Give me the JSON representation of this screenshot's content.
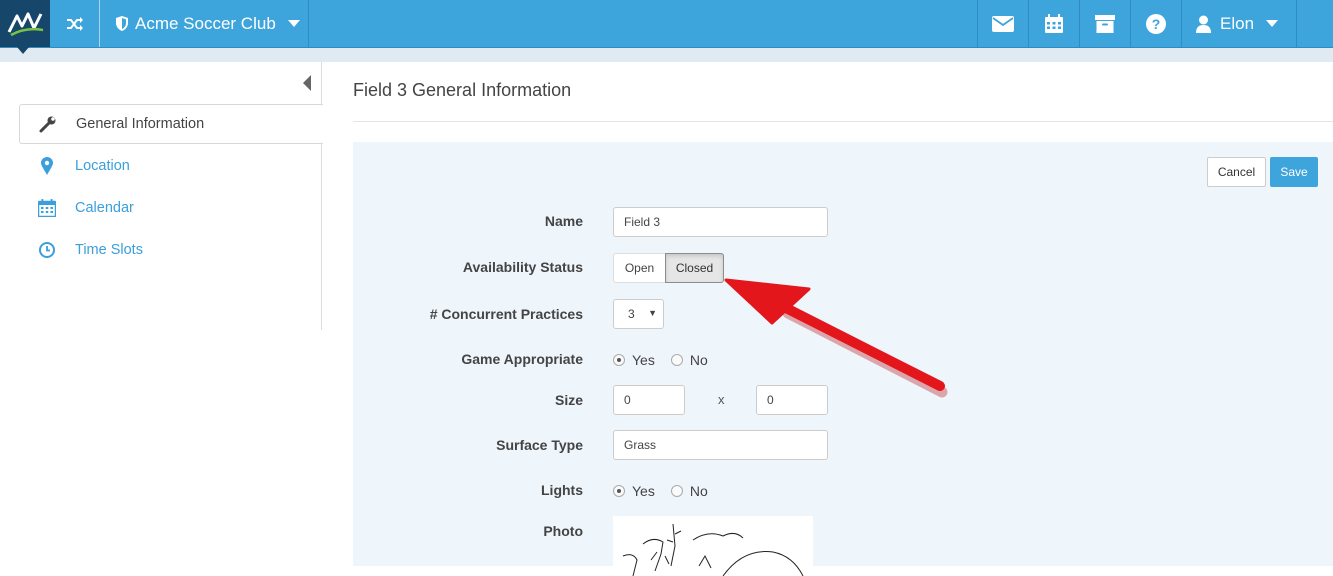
{
  "topbar": {
    "club_name": "Acme Soccer Club",
    "user_name": "Elon",
    "icons": [
      "shuffle-icon",
      "shield-icon",
      "envelope-icon",
      "calendar-icon",
      "archive-icon",
      "help-icon",
      "user-icon"
    ],
    "accent_color": "#3da5dc",
    "logo_bg": "#17466b"
  },
  "sidebar": {
    "items": [
      {
        "label": "General Information",
        "icon": "wrench-icon",
        "active": true
      },
      {
        "label": "Location",
        "icon": "map-marker-icon",
        "active": false
      },
      {
        "label": "Calendar",
        "icon": "calendar-icon",
        "active": false
      },
      {
        "label": "Time Slots",
        "icon": "clock-icon",
        "active": false
      }
    ]
  },
  "main": {
    "title": "Field 3 General Information",
    "actions": {
      "cancel_label": "Cancel",
      "save_label": "Save"
    },
    "form": {
      "name_label": "Name",
      "name_value": "Field 3",
      "availability_label": "Availability Status",
      "availability_options": [
        "Open",
        "Closed"
      ],
      "availability_selected": "Closed",
      "concurrent_label": "# Concurrent Practices",
      "concurrent_value": "3",
      "game_label": "Game Appropriate",
      "game_options": [
        "Yes",
        "No"
      ],
      "game_selected": "Yes",
      "size_label": "Size",
      "size_width": "0",
      "size_separator": "x",
      "size_height": "0",
      "surface_label": "Surface Type",
      "surface_value": "Grass",
      "lights_label": "Lights",
      "lights_options": [
        "Yes",
        "No"
      ],
      "lights_selected": "Yes",
      "photo_label": "Photo"
    },
    "annotation_color": "#e3161c"
  }
}
